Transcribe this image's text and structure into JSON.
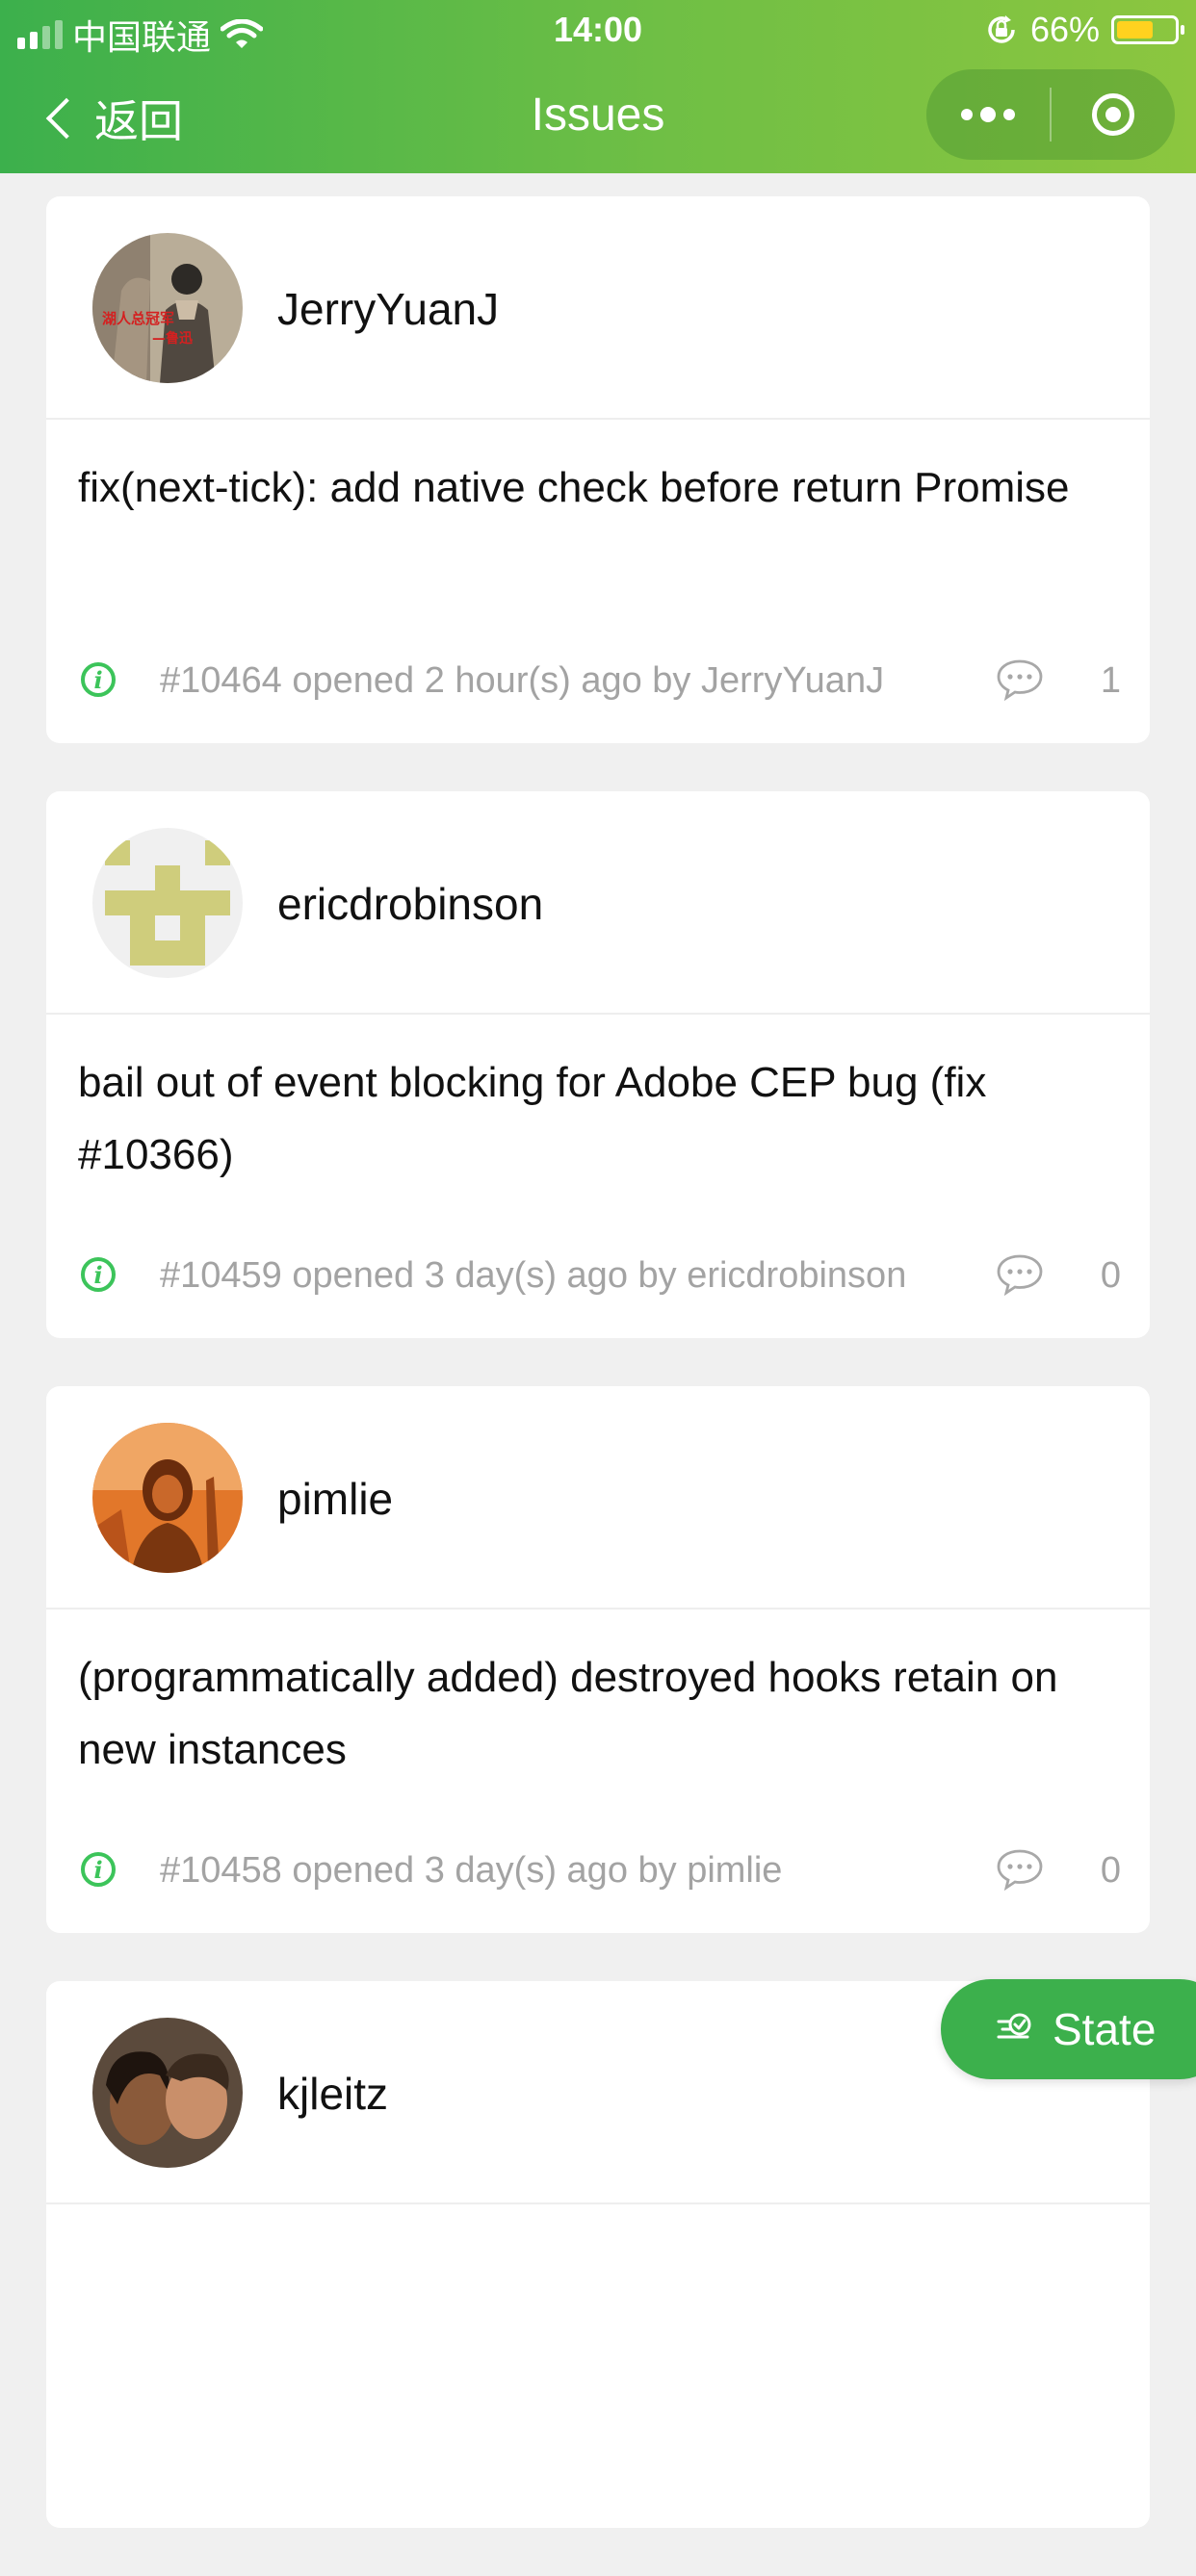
{
  "status_bar": {
    "carrier": "中国联通",
    "time": "14:00",
    "battery_percent": "66%",
    "battery_level": 0.66
  },
  "nav": {
    "back_label": "返回",
    "title": "Issues"
  },
  "issues": [
    {
      "user": "JerryYuanJ",
      "avatar_caption": "湖人总冠军 —鲁迅",
      "title": "fix(next-tick): add native check before return Promise",
      "meta": "#10464 opened 2 hour(s) ago by JerryYuanJ",
      "comments": "1"
    },
    {
      "user": "ericdrobinson",
      "title": "bail out of event blocking for Adobe CEP bug (fix #10366)",
      "meta": "#10459 opened 3 day(s) ago by ericdrobinson",
      "comments": "0"
    },
    {
      "user": "pimlie",
      "title": "(programmatically added) destroyed hooks retain on new instances",
      "meta": "#10458 opened 3 day(s) ago by pimlie",
      "comments": "0"
    },
    {
      "user": "kjleitz"
    }
  ],
  "fab": {
    "label": "State"
  },
  "colors": {
    "accent": "#3cb04c",
    "header_gradient_end": "#8cc63f",
    "info_icon": "#3cc45a",
    "meta_text": "#a3a3a3",
    "battery_fill": "#ffd21f"
  }
}
